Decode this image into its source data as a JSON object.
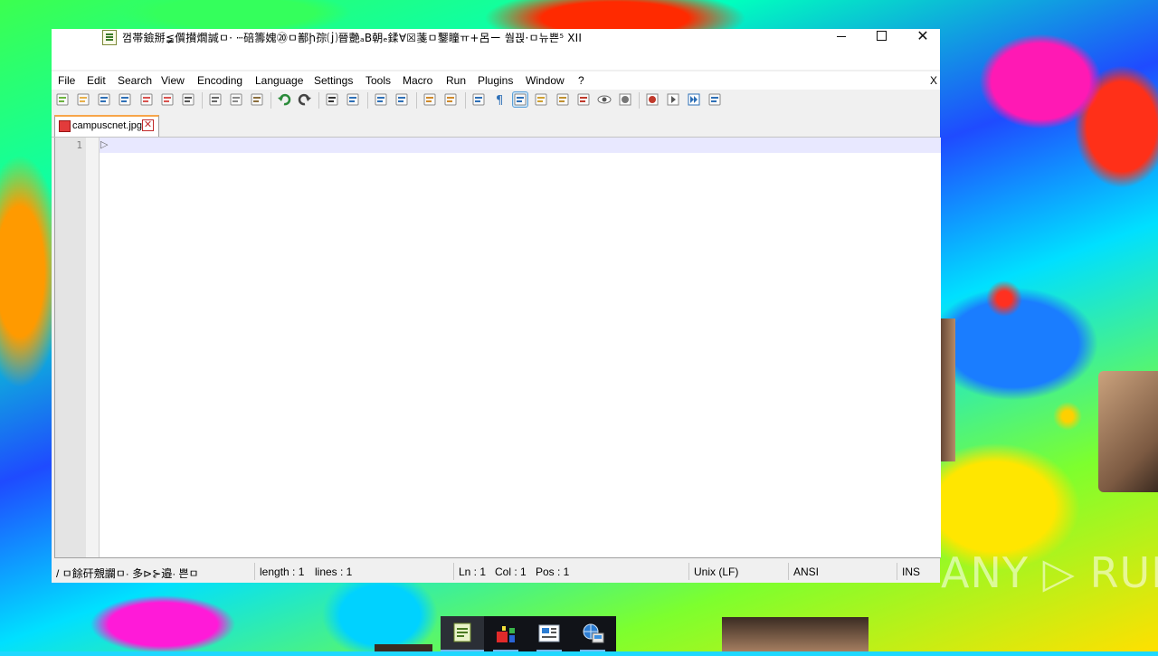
{
  "window": {
    "title": "껌帯鐱掰≨儨攅燗諴ㅁ· ⵈ碚籌媿⑳ㅁ鄯ḩ孮⒥晉艷ₐB朝ₑ鍒∀☒菚ㅁ鑋瞳ㅠ+呂ー 쒐끥·ㅁ뉴쁜⁵ XII",
    "minimize_label": "minimize",
    "maximize_label": "maximize",
    "close_label": "✕"
  },
  "menu": {
    "items": [
      "File",
      "Edit",
      "Search",
      "View",
      "Encoding",
      "Language",
      "Settings",
      "Tools",
      "Macro",
      "Run",
      "Plugins",
      "Window",
      "?"
    ],
    "close_doc": "X"
  },
  "toolbar": {
    "icons": [
      "new-file-icon",
      "open-file-icon",
      "save-icon",
      "save-all-icon",
      "close-icon",
      "close-all-icon",
      "print-icon",
      "cut-icon",
      "copy-icon",
      "paste-icon",
      "undo-icon",
      "redo-icon",
      "find-icon",
      "replace-icon",
      "zoom-in-icon",
      "zoom-out-icon",
      "sync-vertical-icon",
      "sync-horizontal-icon",
      "word-wrap-icon",
      "show-all-chars-icon",
      "indent-guide-icon",
      "document-map-icon",
      "function-list-icon",
      "folder-workspace-icon",
      "monitoring-icon",
      "record-macro-icon",
      "stop-record-icon",
      "play-macro-icon",
      "run-macro-multiple-icon",
      "save-macro-icon"
    ]
  },
  "tabs": [
    {
      "label": "campuscnet.jpg",
      "close": "✕"
    }
  ],
  "editor": {
    "line_numbers": [
      "1"
    ],
    "content_glyph": "▷"
  },
  "status": {
    "file_type": "/ ㅁ餘矸覫讕ㅁ· 多⊳⊱邉· 쁜ㅁ",
    "length": "length : 1",
    "lines": "lines : 1",
    "ln": "Ln : 1",
    "col": "Col : 1",
    "pos": "Pos : 1",
    "eol": "Unix (LF)",
    "encoding": "ANSI",
    "mode": "INS"
  },
  "taskbar": {
    "apps": [
      "notepad-plus-plus-icon",
      "app-colored-blocks-icon",
      "wordpad-icon",
      "network-globe-icon"
    ]
  },
  "watermark": "ANY ▷ RUN",
  "colors": {
    "current_line": "#e8e8ff",
    "tab_accent": "#f7a54a",
    "taskbar": "#111318"
  }
}
